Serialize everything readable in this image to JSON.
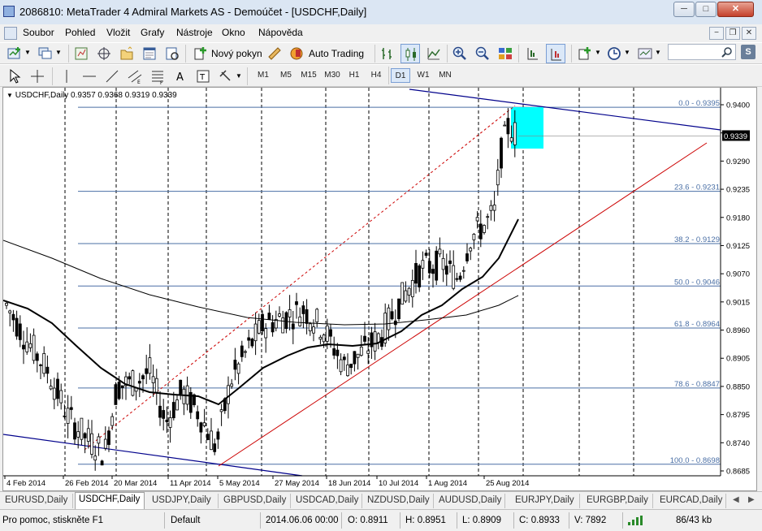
{
  "window": {
    "title": "2086810: MetaTrader 4 Admiral Markets AS - Demoúčet - [USDCHF,Daily]",
    "minimize": "─",
    "maximize": "□",
    "close": "✕"
  },
  "menu": [
    "Soubor",
    "Pohled",
    "Vložit",
    "Grafy",
    "Nástroje",
    "Okno",
    "Nápověda"
  ],
  "mdi_buttons": [
    "−",
    "❐",
    "✕"
  ],
  "toolbar": {
    "new_order": "Nový pokyn",
    "auto_trading": "Auto Trading"
  },
  "timeframes": [
    "M1",
    "M5",
    "M15",
    "M30",
    "H1",
    "H4",
    "D1",
    "W1",
    "MN"
  ],
  "active_timeframe": "D1",
  "chart": {
    "header_symbol": "USDCHF,Daily",
    "header_ohlc": "0.9357 0.9368 0.9319 0.9339",
    "current_price": "0.9339",
    "price_ticks": [
      "0.9400",
      "0.9345",
      "0.9290",
      "0.9235",
      "0.9180",
      "0.9125",
      "0.9070",
      "0.9015",
      "0.8960",
      "0.8905",
      "0.8850",
      "0.8795",
      "0.8740",
      "0.8685"
    ],
    "date_ticks": [
      "4 Feb 2014",
      "26 Feb 2014",
      "20 Mar 2014",
      "11 Apr 2014",
      "5 May 2014",
      "27 May 2014",
      "18 Jun 2014",
      "10 Jul 2014",
      "1 Aug 2014",
      "25 Aug 2014"
    ],
    "fib_levels": [
      {
        "label": "0.0 - 0.9395",
        "price": 0.9395
      },
      {
        "label": "23.6 - 0.9231",
        "price": 0.9231
      },
      {
        "label": "38.2 - 0.9129",
        "price": 0.9129
      },
      {
        "label": "50.0 - 0.9046",
        "price": 0.9046
      },
      {
        "label": "61.8 - 0.8964",
        "price": 0.8964
      },
      {
        "label": "78.6 - 0.8847",
        "price": 0.8847
      },
      {
        "label": "100.0 - 0.8698",
        "price": 0.8698
      }
    ],
    "highlight_color": "#00ffff",
    "bull_line_color": "#cc0000",
    "bear_line_color": "#00008b",
    "fib_color": "#4a6fa5"
  },
  "tabs": [
    "EURUSD,Daily",
    "USDCHF,Daily",
    "USDJPY,Daily",
    "GBPUSD,Daily",
    "USDCAD,Daily",
    "NZDUSD,Daily",
    "AUDUSD,Daily",
    "EURJPY,Daily",
    "EURGBP,Daily",
    "EURCAD,Daily"
  ],
  "active_tab": "USDCHF,Daily",
  "status": {
    "help": "Pro pomoc, stiskněte F1",
    "profile": "Default",
    "datetime": "2014.06.06 00:00",
    "open": "O: 0.8911",
    "high": "H: 0.8951",
    "low": "L: 0.8909",
    "close": "C: 0.8933",
    "volume": "V: 7892",
    "traffic": "86/43 kb"
  }
}
